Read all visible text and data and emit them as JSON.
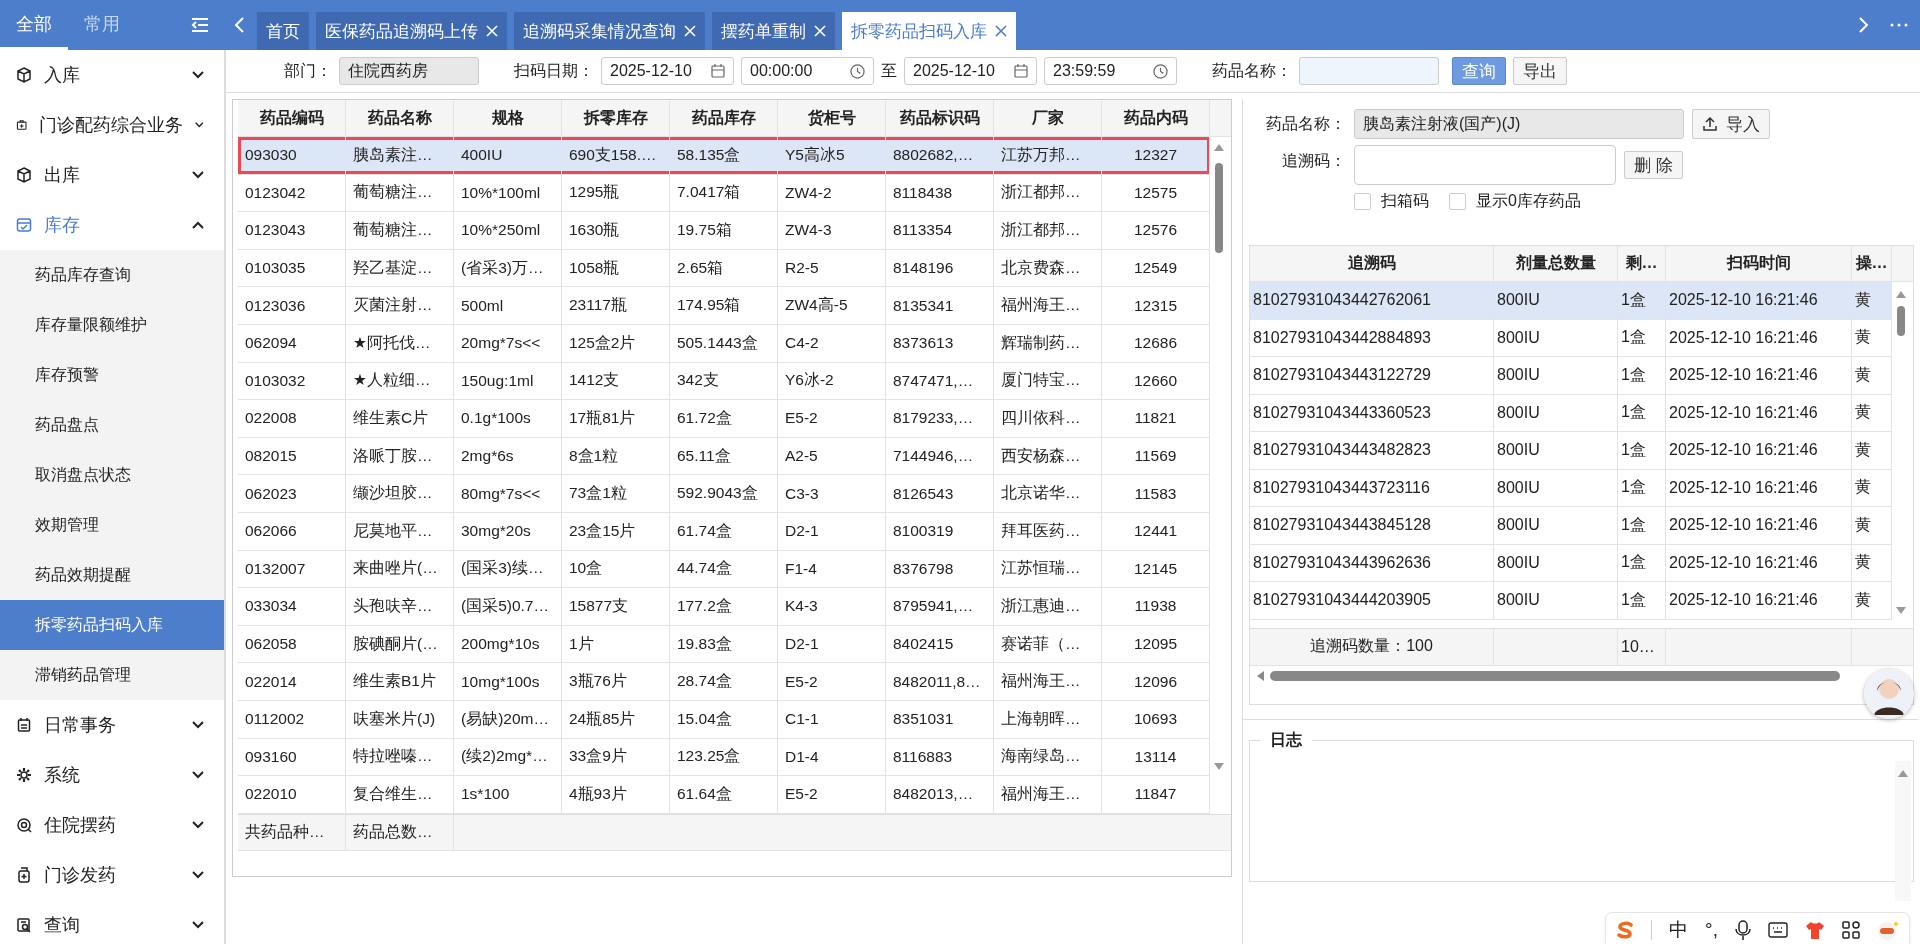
{
  "nav_tabs": [
    {
      "label": "全部",
      "selected": true
    },
    {
      "label": "常用",
      "selected": false
    }
  ],
  "page_tabs": [
    {
      "label": "首页",
      "closable": false,
      "selected": false
    },
    {
      "label": "医保药品追溯码上传",
      "closable": true,
      "selected": false
    },
    {
      "label": "追溯码采集情况查询",
      "closable": true,
      "selected": false
    },
    {
      "label": "摆药单重制",
      "closable": true,
      "selected": false
    },
    {
      "label": "拆零药品扫码入库",
      "closable": true,
      "selected": true
    }
  ],
  "sidebar": {
    "items": [
      {
        "label": "入库",
        "expanded": false
      },
      {
        "label": "门诊配药综合业务",
        "expanded": false
      },
      {
        "label": "出库",
        "expanded": false
      },
      {
        "label": "库存",
        "expanded": true,
        "children": [
          {
            "label": "药品库存查询",
            "selected": false
          },
          {
            "label": "库存量限额维护",
            "selected": false
          },
          {
            "label": "库存预警",
            "selected": false
          },
          {
            "label": "药品盘点",
            "selected": false
          },
          {
            "label": "取消盘点状态",
            "selected": false
          },
          {
            "label": "效期管理",
            "selected": false
          },
          {
            "label": "药品效期提醒",
            "selected": false
          },
          {
            "label": "拆零药品扫码入库",
            "selected": true
          },
          {
            "label": "滞销药品管理",
            "selected": false
          }
        ]
      },
      {
        "label": "日常事务",
        "expanded": false
      },
      {
        "label": "系统",
        "expanded": false
      },
      {
        "label": "住院摆药",
        "expanded": false
      },
      {
        "label": "门诊发药",
        "expanded": false
      },
      {
        "label": "查询",
        "expanded": false
      }
    ]
  },
  "filter": {
    "department_label": "部门：",
    "department": "住院西药房",
    "date_label": "扫码日期：",
    "start_date": "2025-12-10",
    "start_time": "00:00:00",
    "range_separator": "至",
    "end_date": "2025-12-10",
    "end_time": "23:59:59",
    "drug_name_label": "药品名称：",
    "buttons": [
      {
        "label": "查询",
        "kind": "primary"
      },
      {
        "label": "导出",
        "kind": "default"
      }
    ]
  },
  "drug_table": {
    "columns": [
      "药品编码",
      "药品名称",
      "规格",
      "拆零库存",
      "药品库存",
      "货柜号",
      "药品标识码",
      "厂家",
      "药品内码"
    ],
    "rows": [
      {
        "cells": [
          "093030",
          "胰岛素注…",
          "400IU",
          "690支158.…",
          "58.135盒",
          "Y5高冰5",
          "8802682,…",
          "江苏万邦…",
          "12327"
        ],
        "selected": true,
        "outlined": true
      },
      {
        "cells": [
          "0123042",
          "葡萄糖注…",
          "10%*100ml",
          "1295瓶",
          "7.0417箱",
          "ZW4-2",
          "8118438",
          "浙江都邦…",
          "12575"
        ],
        "selected": false,
        "outlined": false
      },
      {
        "cells": [
          "0123043",
          "葡萄糖注…",
          "10%*250ml",
          "1630瓶",
          "19.75箱",
          "ZW4-3",
          "8113354",
          "浙江都邦…",
          "12576"
        ],
        "selected": false,
        "outlined": false
      },
      {
        "cells": [
          "0103035",
          "羟乙基淀…",
          "(省采3)万…",
          "1058瓶",
          "2.65箱",
          "R2-5",
          "8148196",
          "北京费森…",
          "12549"
        ],
        "selected": false,
        "outlined": false
      },
      {
        "cells": [
          "0123036",
          "灭菌注射…",
          "500ml",
          "23117瓶",
          "174.95箱",
          "ZW4高-5",
          "8135341",
          "福州海王…",
          "12315"
        ],
        "selected": false,
        "outlined": false
      },
      {
        "cells": [
          "062094",
          "★阿托伐…",
          "20mg*7s<<",
          "125盒2片",
          "505.1443盒",
          "C4-2",
          "8373613",
          "辉瑞制药…",
          "12686"
        ],
        "selected": false,
        "outlined": false
      },
      {
        "cells": [
          "0103032",
          "★人粒细…",
          "150ug:1ml",
          "1412支",
          "342支",
          "Y6冰-2",
          "8747471,…",
          "厦门特宝…",
          "12660"
        ],
        "selected": false,
        "outlined": false
      },
      {
        "cells": [
          "022008",
          "维生素C片",
          "0.1g*100s",
          "17瓶81片",
          "61.72盒",
          "E5-2",
          "8179233,…",
          "四川依科…",
          "11821"
        ],
        "selected": false,
        "outlined": false
      },
      {
        "cells": [
          "082015",
          "洛哌丁胺…",
          "2mg*6s",
          "8盒1粒",
          "65.11盒",
          "A2-5",
          "7144946,…",
          "西安杨森…",
          "11569"
        ],
        "selected": false,
        "outlined": false
      },
      {
        "cells": [
          "062023",
          "缬沙坦胶…",
          "80mg*7s<<",
          "73盒1粒",
          "592.9043盒",
          "C3-3",
          "8126543",
          "北京诺华…",
          "11583"
        ],
        "selected": false,
        "outlined": false
      },
      {
        "cells": [
          "062066",
          "尼莫地平…",
          "30mg*20s",
          "23盒15片",
          "61.74盒",
          "D2-1",
          "8100319",
          "拜耳医药…",
          "12441"
        ],
        "selected": false,
        "outlined": false
      },
      {
        "cells": [
          "0132007",
          "来曲唑片(…",
          "(国采3)续…",
          "10盒",
          "44.74盒",
          "F1-4",
          "8376798",
          "江苏恒瑞…",
          "12145"
        ],
        "selected": false,
        "outlined": false
      },
      {
        "cells": [
          "033034",
          "头孢呋辛…",
          "(国采5)0.7…",
          "15877支",
          "177.2盒",
          "K4-3",
          "8795941,…",
          "浙江惠迪…",
          "11938"
        ],
        "selected": false,
        "outlined": false
      },
      {
        "cells": [
          "062058",
          "胺碘酮片(…",
          "200mg*10s",
          "1片",
          "19.83盒",
          "D2-1",
          "8402415",
          "赛诺菲（…",
          "12095"
        ],
        "selected": false,
        "outlined": false
      },
      {
        "cells": [
          "022014",
          "维生素B1片",
          "10mg*100s",
          "3瓶76片",
          "28.74盒",
          "E5-2",
          "8482011,8…",
          "福州海王…",
          "12096"
        ],
        "selected": false,
        "outlined": false
      },
      {
        "cells": [
          "0112002",
          "呋塞米片(J)",
          "(易缺)20m…",
          "24瓶85片",
          "15.04盒",
          "C1-1",
          "8351031",
          "上海朝晖…",
          "10693"
        ],
        "selected": false,
        "outlined": false
      },
      {
        "cells": [
          "093160",
          "特拉唑嗪…",
          "(续2)2mg*…",
          "33盒9片",
          "123.25盒",
          "D1-4",
          "8116883",
          "海南绿岛…",
          "13114"
        ],
        "selected": false,
        "outlined": false
      },
      {
        "cells": [
          "022010",
          "复合维生…",
          "1s*100",
          "4瓶93片",
          "61.64盒",
          "E5-2",
          "8482013,…",
          "福州海王…",
          "11847"
        ],
        "selected": false,
        "outlined": false
      }
    ],
    "footer": [
      "共药品种…",
      "药品总数…"
    ]
  },
  "detail": {
    "drug_name_label": "药品名称：",
    "drug_name": "胰岛素注射液(国产)(J)",
    "import_button": "导入",
    "trace_code_label": "追溯码：",
    "delete_button": "删 除",
    "options": [
      {
        "label": "扫箱码",
        "checked": false
      },
      {
        "label": "显示0库存药品",
        "checked": false
      }
    ],
    "trace_table": {
      "columns": [
        "追溯码",
        "剂量总数量",
        "剩…",
        "扫码时间",
        "操…"
      ],
      "rows": [
        {
          "cells": [
            "81027931043442762061",
            "800IU",
            "1盒",
            "2025-12-10 16:21:46",
            "黄"
          ],
          "selected": true
        },
        {
          "cells": [
            "81027931043442884893",
            "800IU",
            "1盒",
            "2025-12-10 16:21:46",
            "黄"
          ],
          "selected": false
        },
        {
          "cells": [
            "81027931043443122729",
            "800IU",
            "1盒",
            "2025-12-10 16:21:46",
            "黄"
          ],
          "selected": false
        },
        {
          "cells": [
            "81027931043443360523",
            "800IU",
            "1盒",
            "2025-12-10 16:21:46",
            "黄"
          ],
          "selected": false
        },
        {
          "cells": [
            "81027931043443482823",
            "800IU",
            "1盒",
            "2025-12-10 16:21:46",
            "黄"
          ],
          "selected": false
        },
        {
          "cells": [
            "81027931043443723116",
            "800IU",
            "1盒",
            "2025-12-10 16:21:46",
            "黄"
          ],
          "selected": false
        },
        {
          "cells": [
            "81027931043443845128",
            "800IU",
            "1盒",
            "2025-12-10 16:21:46",
            "黄"
          ],
          "selected": false
        },
        {
          "cells": [
            "81027931043443962636",
            "800IU",
            "1盒",
            "2025-12-10 16:21:46",
            "黄"
          ],
          "selected": false
        },
        {
          "cells": [
            "81027931043444203905",
            "800IU",
            "1盒",
            "2025-12-10 16:21:46",
            "黄"
          ],
          "selected": false
        }
      ],
      "footer": {
        "count": "追溯码数量：100",
        "remaining": "10…"
      }
    }
  },
  "log": {
    "title": "日志"
  },
  "ime_toolbar": {
    "mode": "中",
    "punctuation": "°,"
  }
}
